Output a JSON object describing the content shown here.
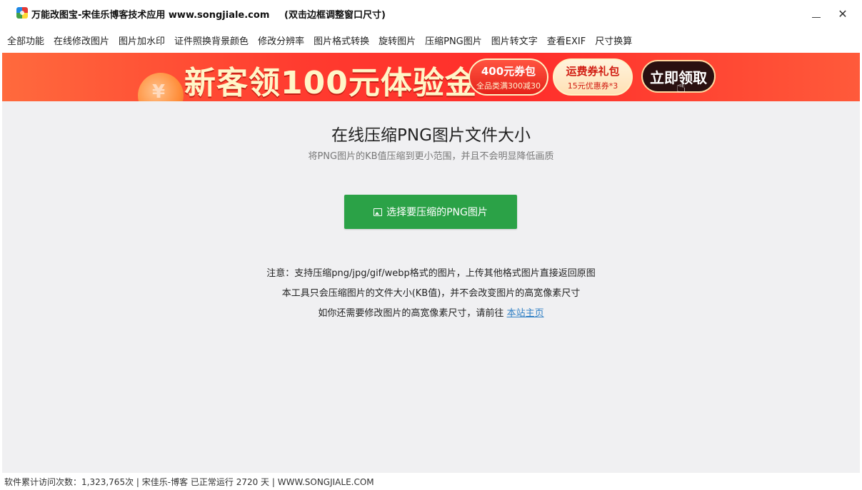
{
  "window": {
    "title": "万能改图宝-宋佳乐博客技术应用 www.songjiale.com",
    "hint": "(双击边框调整窗口尺寸)",
    "minimize_glyph": "_",
    "close_glyph": "✕"
  },
  "menu": {
    "items": [
      {
        "label": "全部功能"
      },
      {
        "label": "在线修改图片"
      },
      {
        "label": "图片加水印"
      },
      {
        "label": "证件照换背景颜色"
      },
      {
        "label": "修改分辨率"
      },
      {
        "label": "图片格式转换"
      },
      {
        "label": "旋转图片"
      },
      {
        "label": "压缩PNG图片"
      },
      {
        "label": "图片转文字"
      },
      {
        "label": "查看EXIF"
      },
      {
        "label": "尺寸换算"
      }
    ]
  },
  "banner": {
    "headline": "新客领100元体验金",
    "coin_mark": "¥",
    "coupon1": {
      "main": "400元券包",
      "sub": "全品类满300减30"
    },
    "coupon2": {
      "main": "运费券礼包",
      "sub": "15元优惠券*3"
    },
    "claim_label": "立即领取",
    "colors": {
      "bg": "#ff3b2f",
      "headline": "#fff6c8"
    }
  },
  "main": {
    "title": "在线压缩PNG图片文件大小",
    "subtitle": "将PNG图片的KB值压缩到更小范围，并且不会明显降低画质",
    "choose_button": "选择要压缩的PNG图片",
    "choose_button_color": "#2ba247",
    "note1": "注意：支持压缩png/jpg/gif/webp格式的图片，上传其他格式图片直接返回原图",
    "note2": "本工具只会压缩图片的文件大小(KB值)，并不会改变图片的高宽像素尺寸",
    "note3_prefix": "如你还需要修改图片的高宽像素尺寸，请前往 ",
    "note3_link": "本站主页"
  },
  "status": {
    "text": "软件累计访问次数：1,323,765次 | 宋佳乐-博客 已正常运行 2720 天 | WWW.SONGJIALE.COM"
  }
}
